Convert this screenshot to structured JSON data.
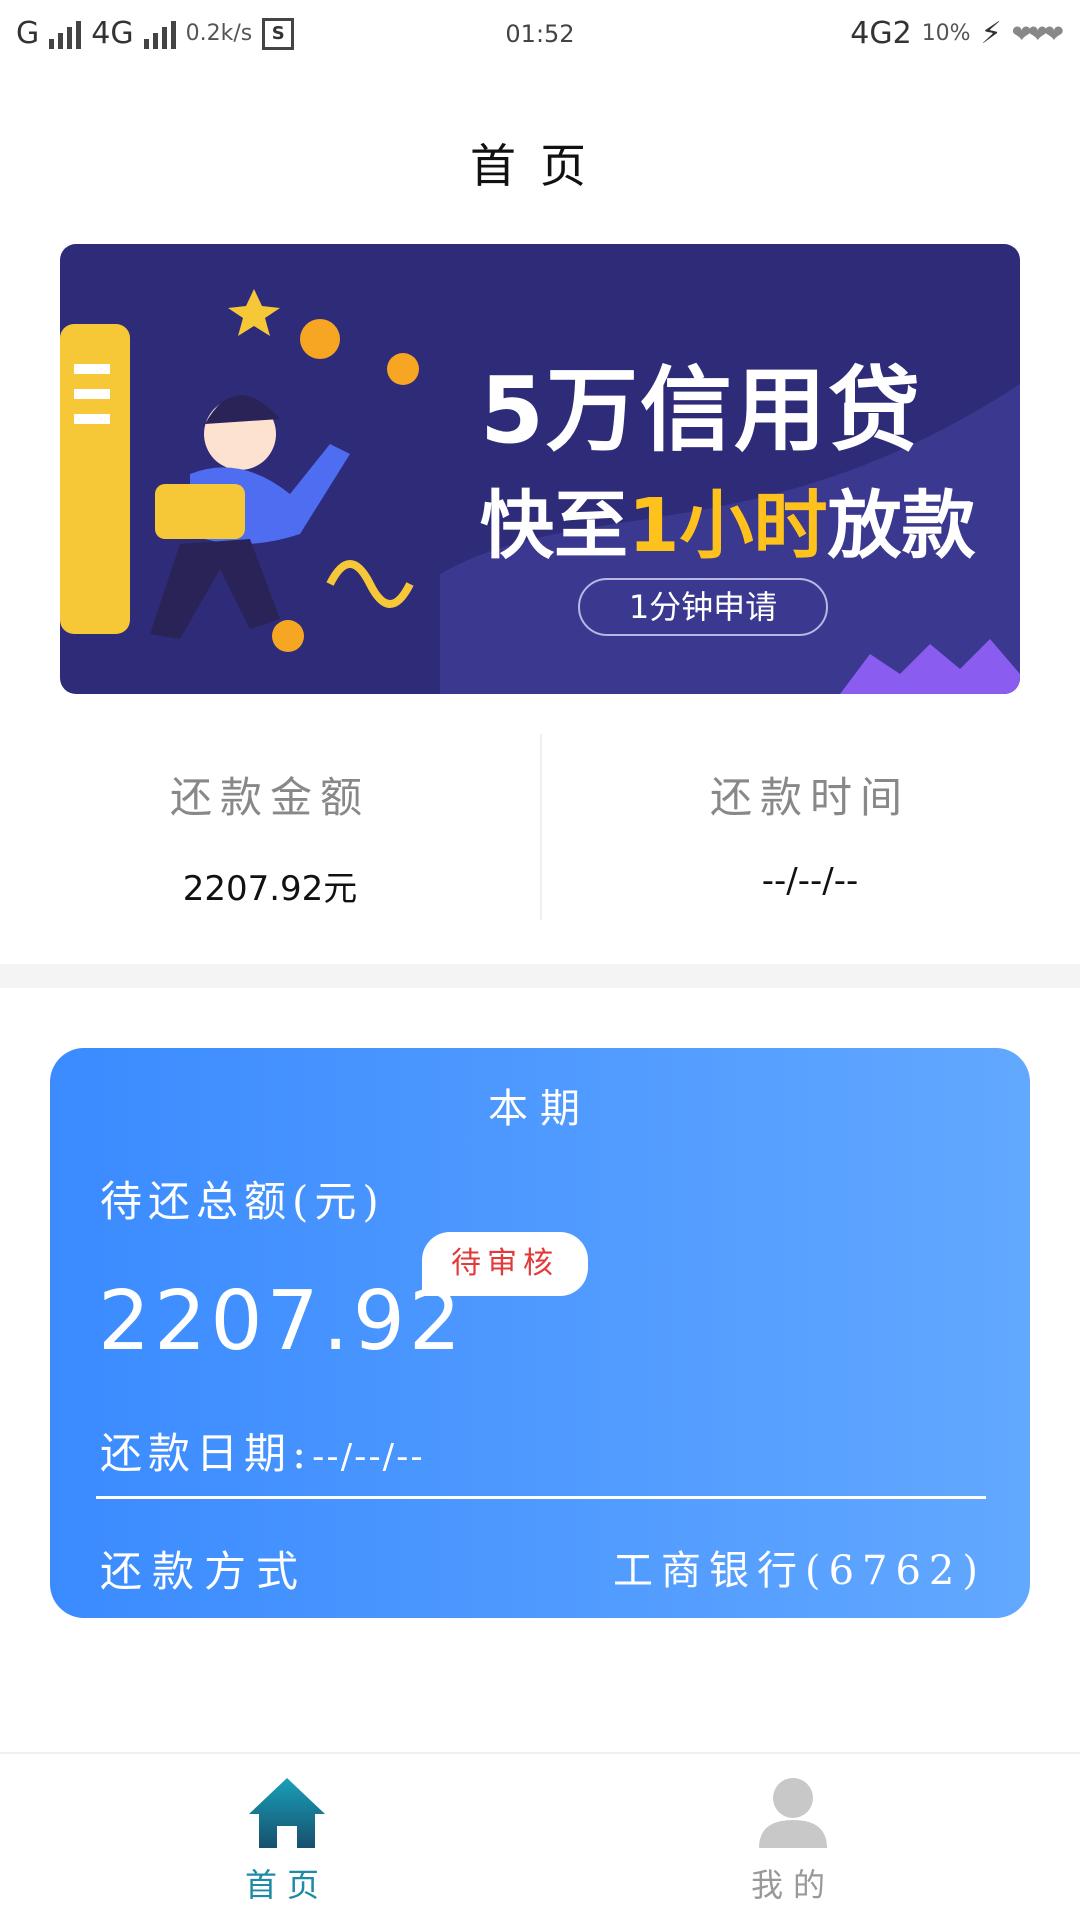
{
  "status_bar": {
    "carrier1": "G",
    "carrier2": "4G",
    "speed": "0.2k/s",
    "s_icon": "S",
    "time": "01:52",
    "network_right": "4G2",
    "battery": "10%"
  },
  "page_title": "首页",
  "banner": {
    "line1": "5万信用贷",
    "line2_a": "快至",
    "line2_highlight": "1小时",
    "line2_b": "放款",
    "button": "1分钟申请"
  },
  "summary": {
    "amount_label": "还款金额",
    "amount_value": "2207.92元",
    "time_label": "还款时间",
    "time_value": "--/--/--"
  },
  "card": {
    "title": "本期",
    "due_label": "待还总额(元)",
    "badge": "待审核",
    "amount": "2207.92",
    "date_label": "还款日期:",
    "date_value": "--/--/--",
    "method_label": "还款方式",
    "bank": "工商银行(6762)"
  },
  "bottom_nav": {
    "home": "首页",
    "mine": "我的"
  },
  "colors": {
    "card_start": "#3b8bff",
    "card_end": "#62a8ff",
    "badge_text": "#e23a3a",
    "nav_active": "#1f8aa6",
    "banner_bg": "#2e2b78",
    "banner_highlight": "#ffc21c"
  }
}
